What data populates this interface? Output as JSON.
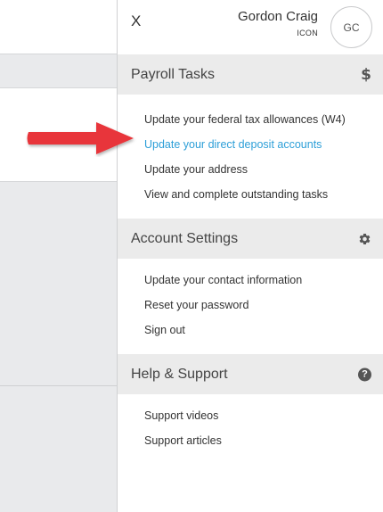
{
  "header": {
    "close_label": "X",
    "user_name": "Gordon Craig",
    "user_org": "ICON",
    "avatar_initials": "GC"
  },
  "sections": [
    {
      "title": "Payroll Tasks",
      "icon": "dollar-icon",
      "links": [
        "Update your federal tax allowances (W4)",
        "Update your direct deposit accounts",
        "Update your address",
        "View and complete outstanding tasks"
      ]
    },
    {
      "title": "Account Settings",
      "icon": "gear-icon",
      "links": [
        "Update your contact information",
        "Reset your password",
        "Sign out"
      ]
    },
    {
      "title": "Help & Support",
      "icon": "question-icon",
      "links": [
        "Support videos",
        "Support articles"
      ]
    }
  ],
  "colors": {
    "link_highlight": "#2d9fd8",
    "section_bg": "#ebebeb",
    "arrow": "#e8363a"
  },
  "annotation": {
    "arrow_target": "Update your direct deposit accounts"
  }
}
